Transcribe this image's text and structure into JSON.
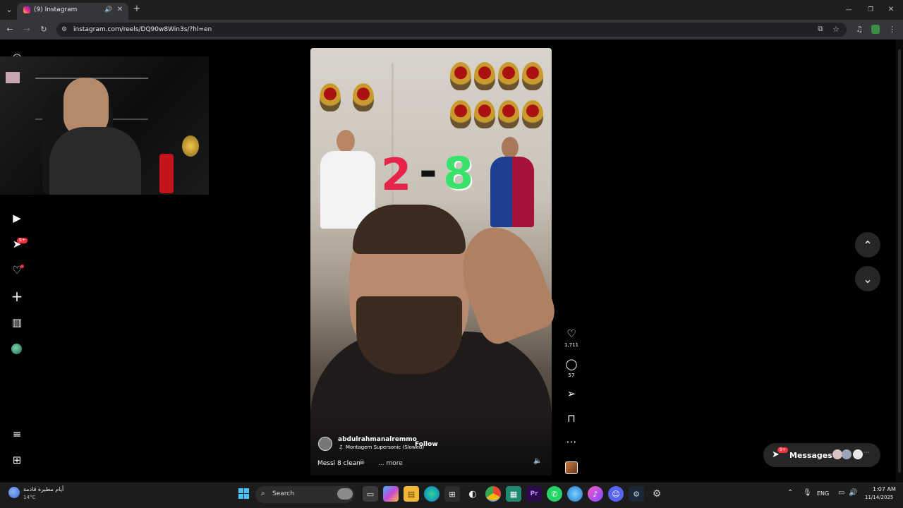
{
  "browser": {
    "tab_title": "(9) Instagram",
    "url": "instagram.com/reels/DQ90w8Win3s/?hl=en",
    "new_tab": "+",
    "minimize": "—",
    "restore": "❐",
    "close": "✕"
  },
  "sidebar": {
    "notifications_badge": "9+"
  },
  "reel": {
    "score_left": "2",
    "score_dash": "-",
    "score_right": "8",
    "author": "abdulrahmanalremmo",
    "follow_label": "Follow",
    "audio": "Montagem Supersonic (Slowed)",
    "caption": "Messi 8 clean",
    "more_label": "... more",
    "likes": "1,711",
    "comments": "57"
  },
  "messages": {
    "label": "Messages",
    "badge": "9+"
  },
  "taskbar": {
    "weather_text": "أيام مطيرة قادمة",
    "temperature": "14°C",
    "search_placeholder": "Search",
    "language": "ENG",
    "time": "1:07 AM",
    "date": "11/14/2025"
  },
  "colors": {
    "chrome_bg": "#1f1f1f",
    "toolbar_bg": "#35363a",
    "badge_red": "#ff3040",
    "score_left": "#e8234a",
    "score_right": "#39e36b"
  }
}
